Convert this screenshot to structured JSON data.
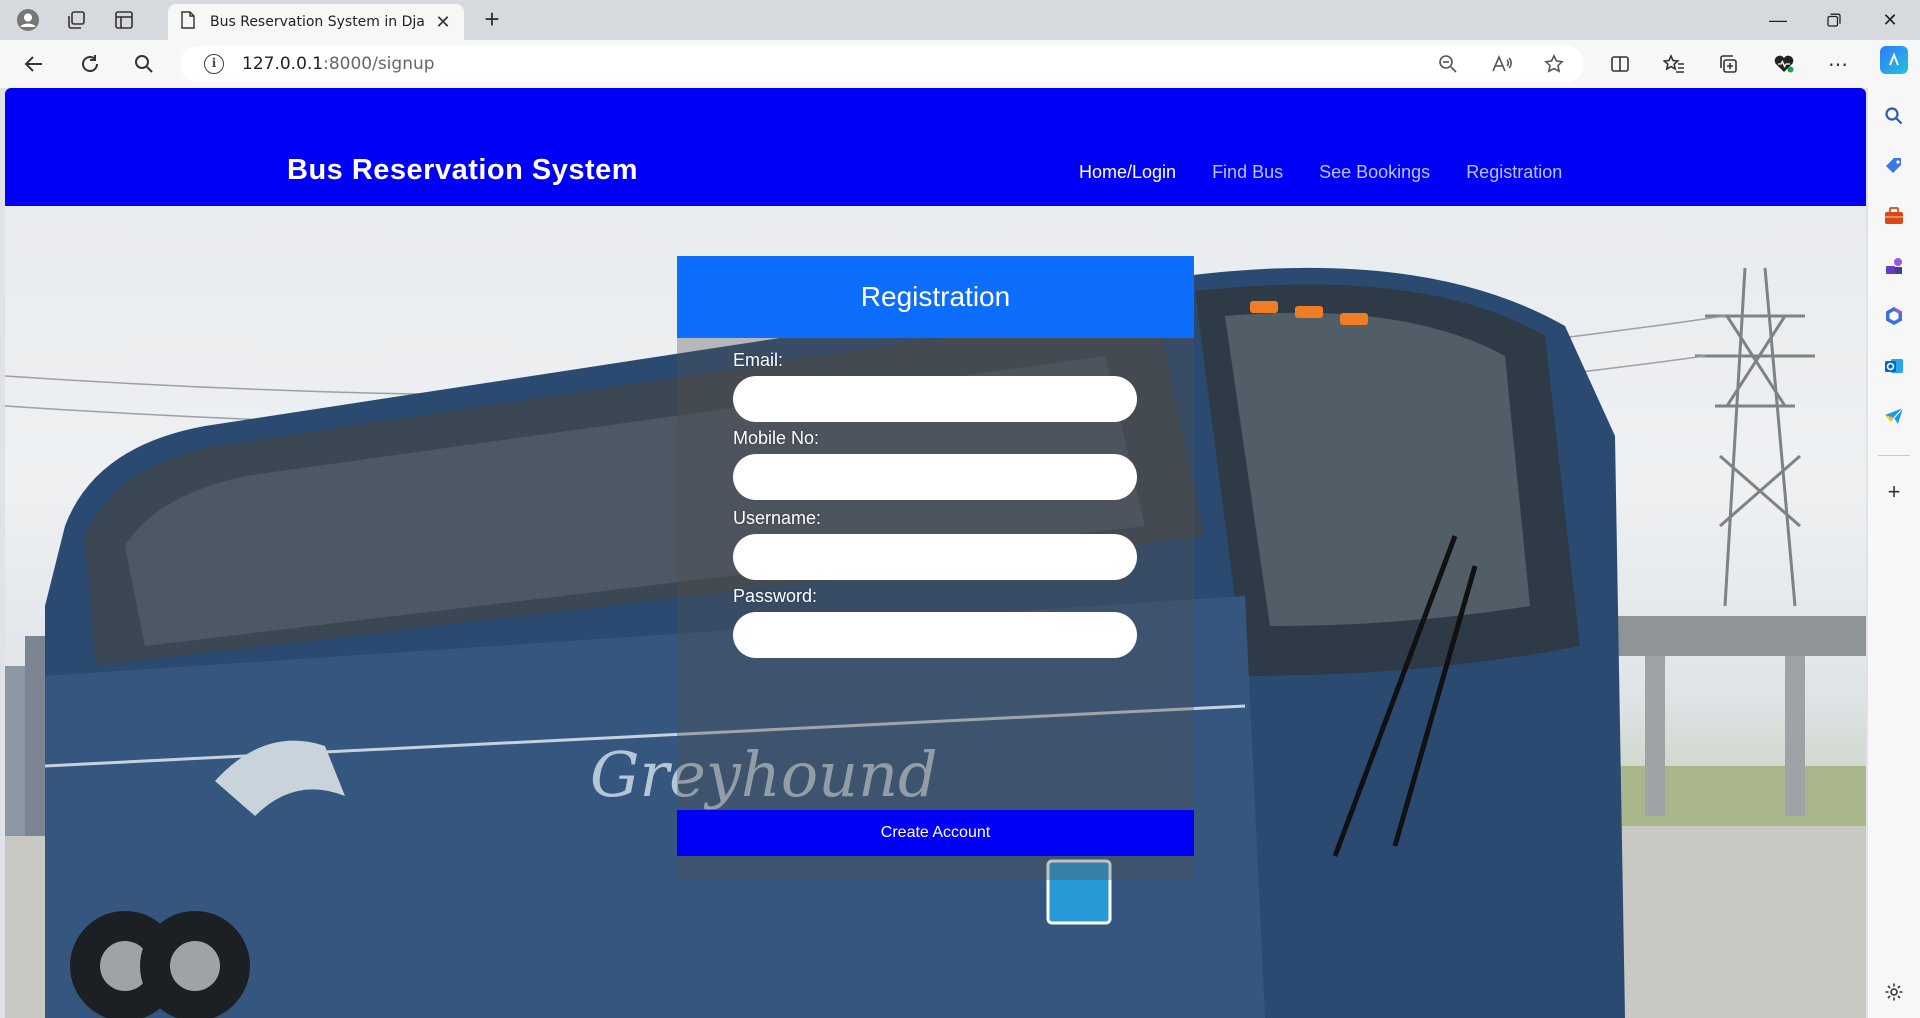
{
  "browser": {
    "tab_title": "Bus Reservation System in Djang",
    "url_host": "127.0.0.1",
    "url_path": ":8000/signup"
  },
  "site": {
    "brand": "Bus Reservation System",
    "nav": [
      {
        "label": "Home/Login",
        "active": true
      },
      {
        "label": "Find Bus",
        "active": false
      },
      {
        "label": "See Bookings",
        "active": false
      },
      {
        "label": "Registration",
        "active": false
      }
    ]
  },
  "form": {
    "title": "Registration",
    "fields": [
      {
        "label": "Email:",
        "value": "",
        "type": "email"
      },
      {
        "label": "Mobile No:",
        "value": "",
        "type": "text"
      },
      {
        "label": "Username:",
        "value": "",
        "type": "text"
      },
      {
        "label": "Password:",
        "value": "",
        "type": "password"
      }
    ],
    "submit_label": "Create Account"
  },
  "hero": {
    "bus_lettering": "Greyhound"
  },
  "colors": {
    "navbar": "#0000f7",
    "card_header": "#0d6efd",
    "submit": "#0000f7"
  }
}
